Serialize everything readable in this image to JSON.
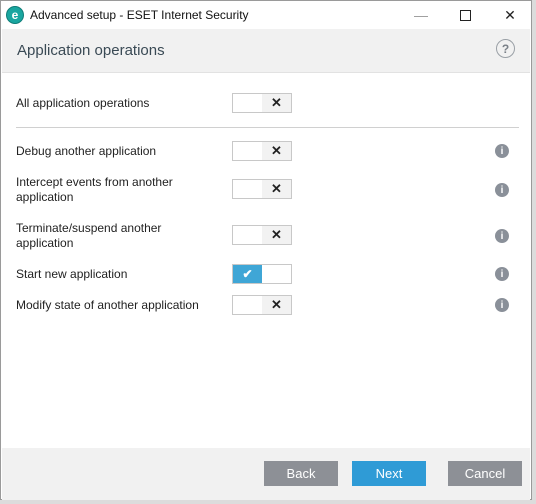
{
  "window": {
    "title": "Advanced setup - ESET Internet Security",
    "icon_letter": "e",
    "controls": {
      "minimize": "—",
      "close": "✕"
    }
  },
  "header": {
    "title": "Application operations",
    "help": "?"
  },
  "rows": [
    {
      "label": "All application operations",
      "state": "off",
      "info": false
    },
    {
      "label": "Debug another application",
      "state": "off",
      "info": true
    },
    {
      "label": "Intercept events from another application",
      "state": "off",
      "info": true
    },
    {
      "label": "Terminate/suspend another application",
      "state": "off",
      "info": true
    },
    {
      "label": "Start new application",
      "state": "on",
      "info": true
    },
    {
      "label": "Modify state of another application",
      "state": "off",
      "info": true
    }
  ],
  "glyphs": {
    "off": "✕",
    "on": "✔",
    "info": "i"
  },
  "footer": {
    "back": "Back",
    "next": "Next",
    "cancel": "Cancel"
  },
  "colors": {
    "accent": "#2f9bd6",
    "toggle_on": "#3fa6d6",
    "button_gray": "#8d9096",
    "brand": "#1aa6a0"
  }
}
